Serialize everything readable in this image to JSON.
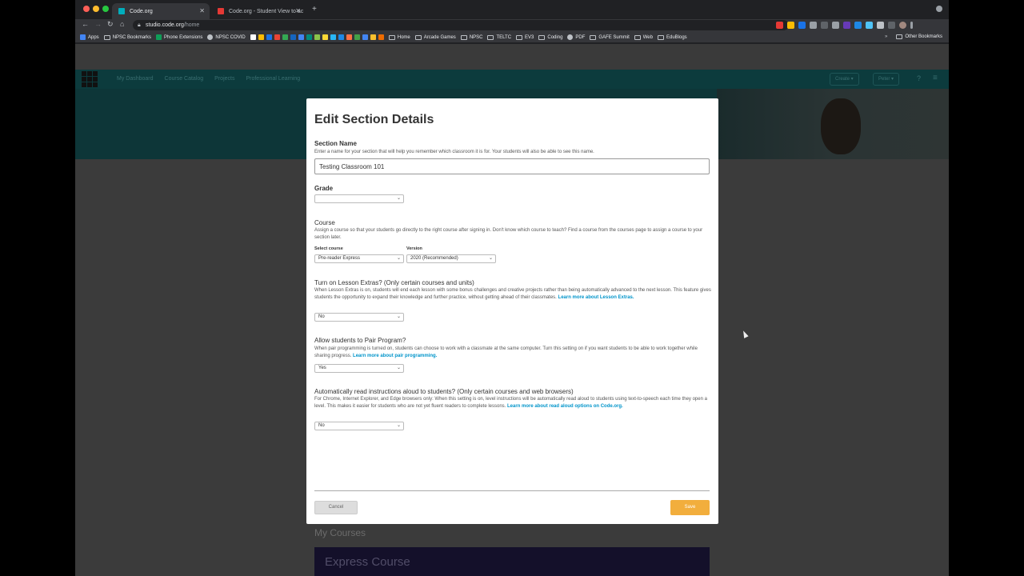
{
  "browser": {
    "tabs": [
      {
        "title": "Code.org",
        "favicon_color": "#00adbc",
        "active": true
      },
      {
        "title": "Code.org - Student View to ac",
        "favicon_color": "#e53935",
        "active": false
      }
    ],
    "url_host": "studio.code.org",
    "url_path": "/home",
    "bookmarks": [
      {
        "label": "Apps",
        "icon": "apps-grid-icon",
        "color": "#4285f4"
      },
      {
        "label": "NPSC Bookmarks",
        "icon": "folder-icon"
      },
      {
        "label": "Phone Extensions",
        "icon": "sheets-icon",
        "color": "#0f9d58"
      },
      {
        "label": "NPSC COVID",
        "icon": "globe-icon",
        "color": "#bdc1c6"
      }
    ],
    "bookmark_folders": [
      "Home",
      "Arcade Games",
      "NPSC",
      "TELTC",
      "EV3",
      "Coding",
      "PDF",
      "GAFE Summit",
      "Web",
      "EduBlogs"
    ],
    "other_bookmarks": "Other Bookmarks"
  },
  "site_header": {
    "links": [
      "My Dashboard",
      "Course Catalog",
      "Projects",
      "Professional Learning"
    ],
    "create_label": "Create",
    "user_label": "Peter"
  },
  "background": {
    "my_courses": "My Courses",
    "course_card": "Express Course"
  },
  "modal": {
    "title": "Edit Section Details",
    "section_name": {
      "label": "Section Name",
      "description": "Enter a name for your section that will help you remember which classroom it is for. Your students will also be able to see this name.",
      "value": "Testing Classroom 101"
    },
    "grade": {
      "label": "Grade",
      "value": ""
    },
    "course": {
      "label": "Course",
      "description": "Assign a course so that your students go directly to the right course after signing in. Don't know which course to teach? Find a course from the courses page to assign a course to your section later.",
      "select_course_label": "Select course",
      "select_course_value": "Pre-reader Express",
      "version_label": "Version",
      "version_value": "2020 (Recommended)"
    },
    "lesson_extras": {
      "label": "Turn on Lesson Extras? (Only certain courses and units)",
      "description": "When Lesson Extras is on, students will end each lesson with some bonus challenges and creative projects rather than being automatically advanced to the next lesson. This feature gives students the opportunity to expand their knowledge and further practice, without getting ahead of their classmates.",
      "link": "Learn more about Lesson Extras.",
      "value": "No"
    },
    "pair_program": {
      "label": "Allow students to Pair Program?",
      "description": "When pair programming is turned on, students can choose to work with a classmate at the same computer. Turn this setting on if you want students to be able to work together while sharing progress.",
      "link": "Learn more about pair programming.",
      "value": "Yes"
    },
    "read_aloud": {
      "label": "Automatically read instructions aloud to students? (Only certain courses and web browsers)",
      "description": "For Chrome, Internet Explorer, and Edge browsers only: When this setting is on, level instructions will be automatically read aloud to students using text-to-speech each time they open a level. This makes it easier for students who are not yet fluent readers to complete lessons.",
      "link": "Learn more about read aloud options on Code.org.",
      "value": "No"
    },
    "cancel_label": "Cancel",
    "save_label": "Save"
  },
  "colors": {
    "save": "#f2ae3d",
    "link": "#0094ca",
    "header": "#0c3b3d"
  }
}
